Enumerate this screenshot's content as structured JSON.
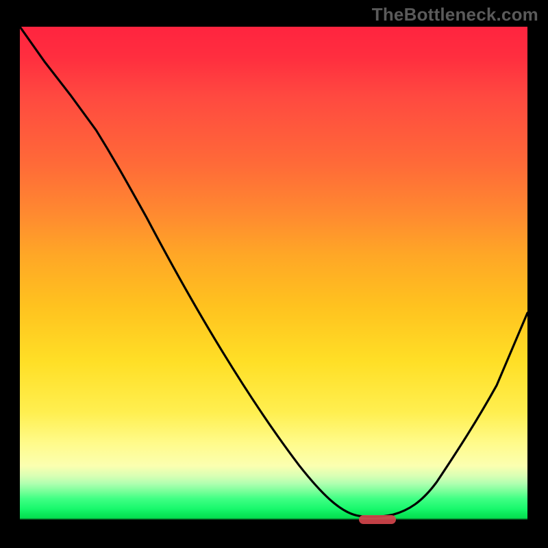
{
  "watermark": "TheBottleneck.com",
  "chart_data": {
    "type": "line",
    "title": "",
    "xlabel": "",
    "ylabel": "",
    "xlim": [
      0,
      100
    ],
    "ylim": [
      0,
      100
    ],
    "x": [
      0,
      5,
      10,
      15,
      20,
      25,
      30,
      35,
      40,
      45,
      50,
      55,
      60,
      65,
      67,
      69,
      73,
      76,
      80,
      85,
      90,
      95,
      100
    ],
    "values": [
      100,
      93,
      86,
      79,
      73,
      67.5,
      62,
      55,
      47,
      39,
      31,
      23,
      15,
      7,
      3,
      1,
      0.5,
      0.5,
      2.5,
      10,
      21,
      32,
      44
    ],
    "optimum_range_x": [
      67,
      74
    ],
    "background_gradient": {
      "stops": [
        {
          "pos": 0.0,
          "color": "#ff243f"
        },
        {
          "pos": 0.27,
          "color": "#ff6a38"
        },
        {
          "pos": 0.55,
          "color": "#ffc21f"
        },
        {
          "pos": 0.82,
          "color": "#fffb8a"
        },
        {
          "pos": 0.93,
          "color": "#3fff84"
        },
        {
          "pos": 0.968,
          "color": "#06e050"
        },
        {
          "pos": 0.972,
          "color": "#000000"
        },
        {
          "pos": 1.0,
          "color": "#000000"
        }
      ]
    },
    "marker": {
      "x_center": 70.5,
      "y": 0.5,
      "color": "#d3454c"
    }
  }
}
